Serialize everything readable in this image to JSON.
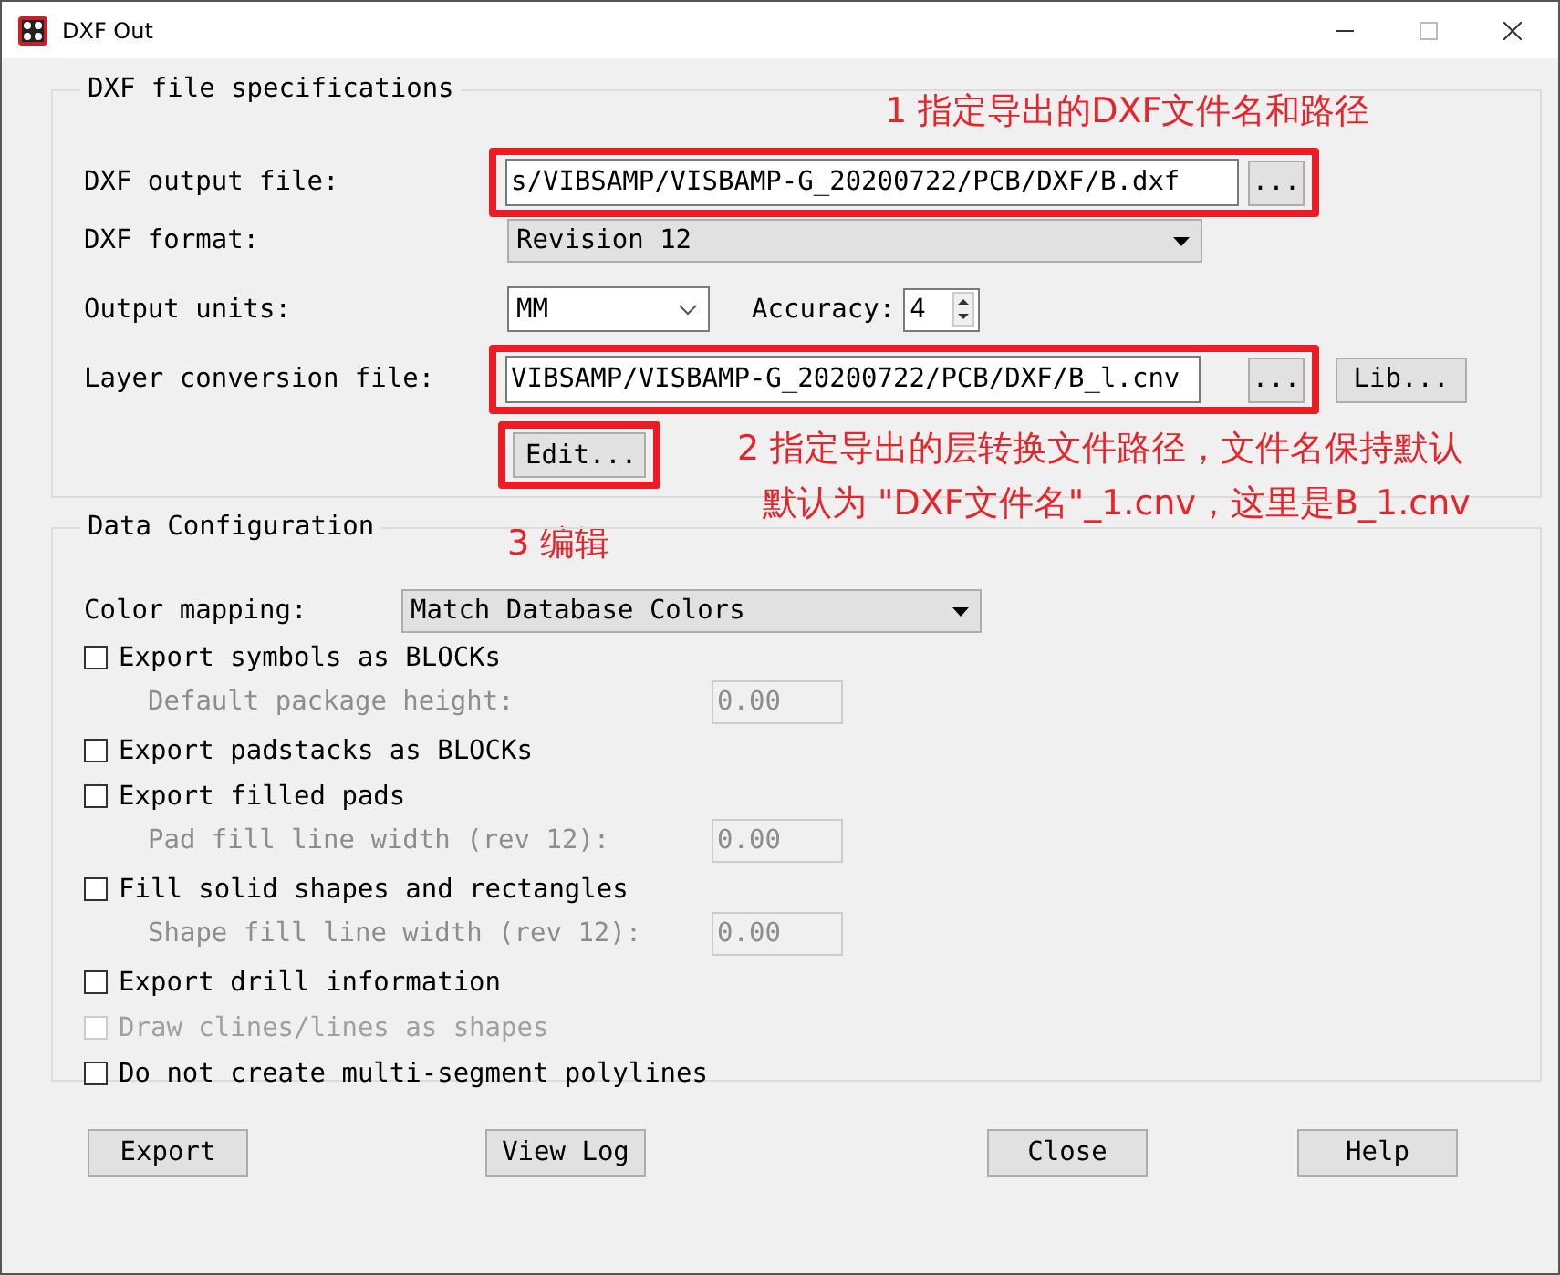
{
  "window": {
    "title": "DXF Out"
  },
  "file_specs": {
    "title": "DXF file specifications",
    "output_file": {
      "label": "DXF output file:",
      "value": "s/VIBSAMP/VISBAMP-G_20200722/PCB/DXF/B.dxf",
      "browse": "...",
      "note": "1 指定导出的DXF文件名和路径"
    },
    "format": {
      "label": "DXF format:",
      "value": "Revision 12"
    },
    "units": {
      "label": "Output units:",
      "value": "MM"
    },
    "accuracy": {
      "label": "Accuracy:",
      "value": "4"
    },
    "layer_file": {
      "label": "Layer conversion file:",
      "value": "VIBSAMP/VISBAMP-G_20200722/PCB/DXF/B_l.cnv",
      "browse": "...",
      "lib": "Lib...",
      "note_lines": [
        "2 指定导出的层转换文件路径，文件名保持默认",
        "默认为 \"DXF文件名\"_1.cnv，这里是B_1.cnv"
      ]
    },
    "edit": {
      "label": "Edit...",
      "note": "3 编辑"
    }
  },
  "data_config": {
    "title": "Data Configuration",
    "color_mapping": {
      "label": "Color mapping:",
      "value": "Match Database Colors"
    },
    "options": [
      {
        "kind": "checkbox",
        "label": "Export symbols as BLOCKs",
        "checked": false,
        "disabled": false
      },
      {
        "kind": "field",
        "label": "Default package height:",
        "value": "0.00",
        "disabled": true
      },
      {
        "kind": "checkbox",
        "label": "Export padstacks as BLOCKs",
        "checked": false,
        "disabled": false
      },
      {
        "kind": "checkbox",
        "label": "Export filled pads",
        "checked": false,
        "disabled": false
      },
      {
        "kind": "field",
        "label": "Pad fill line width (rev 12):",
        "value": "0.00",
        "disabled": true
      },
      {
        "kind": "checkbox",
        "label": "Fill solid shapes and rectangles",
        "checked": false,
        "disabled": false
      },
      {
        "kind": "field",
        "label": "Shape fill line width (rev 12):",
        "value": "0.00",
        "disabled": true
      },
      {
        "kind": "checkbox",
        "label": "Export drill information",
        "checked": false,
        "disabled": false
      },
      {
        "kind": "checkbox",
        "label": "Draw clines/lines as shapes",
        "checked": false,
        "disabled": true
      },
      {
        "kind": "checkbox",
        "label": "Do not create multi-segment polylines",
        "checked": false,
        "disabled": false
      }
    ]
  },
  "buttons": [
    "Export",
    "View Log",
    "Close",
    "Help"
  ]
}
